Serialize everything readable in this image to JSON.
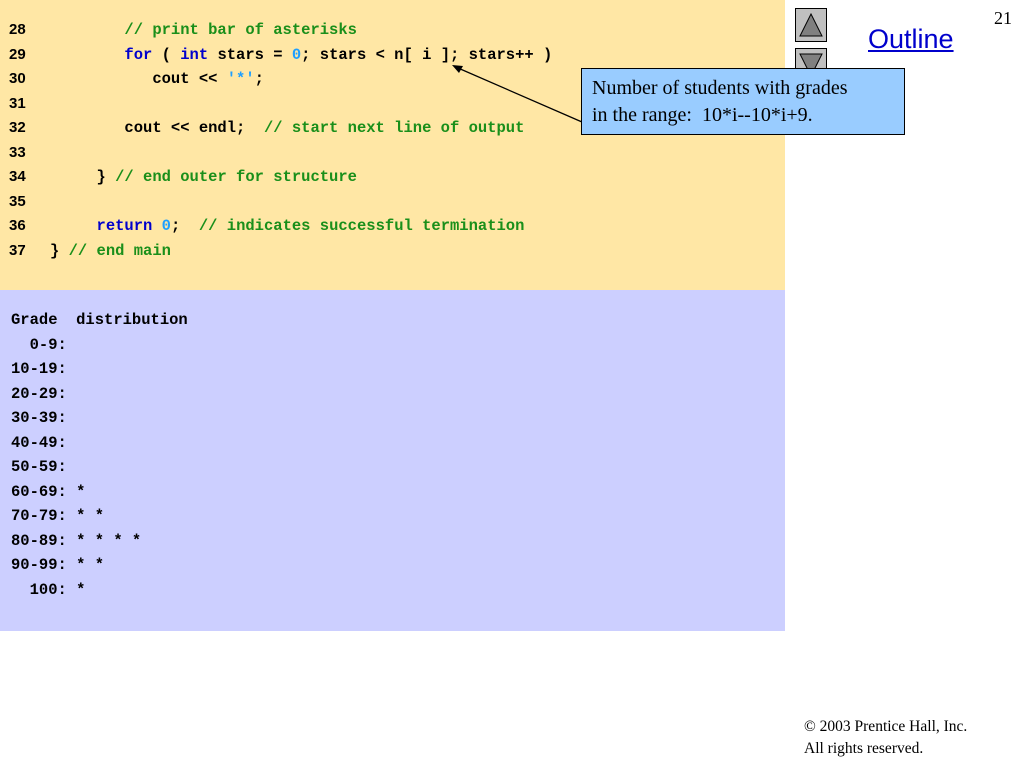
{
  "slide": {
    "page_number": "21",
    "outline_link": "Outline",
    "nav": {
      "up_icon": "triangle-up-icon",
      "down_icon": "triangle-down-icon"
    },
    "copyright": {
      "line1": "© 2003 Prentice Hall, Inc.",
      "line2": "All rights reserved."
    }
  },
  "colors": {
    "code_panel_bg": "#ffe7a5",
    "output_panel_bg": "#cccfff",
    "callout_bg": "#99ccff",
    "keyword": "#0000cc",
    "number_literal": "#1e9fff",
    "comment": "#1a8f1a"
  },
  "code": {
    "lines": [
      {
        "number": "28",
        "parts": [
          {
            "text": "        "
          },
          {
            "text": "// print bar of asterisks",
            "cls": "cm"
          }
        ]
      },
      {
        "number": "29",
        "parts": [
          {
            "text": "        "
          },
          {
            "text": "for",
            "cls": "kw"
          },
          {
            "text": " ( "
          },
          {
            "text": "int",
            "cls": "kw"
          },
          {
            "text": " stars = "
          },
          {
            "text": "0",
            "cls": "num"
          },
          {
            "text": "; stars < n[ i ]; stars++ )"
          }
        ]
      },
      {
        "number": "30",
        "parts": [
          {
            "text": "           cout << "
          },
          {
            "text": "'*'",
            "cls": "num"
          },
          {
            "text": ";"
          }
        ]
      },
      {
        "number": "31",
        "parts": [
          {
            "text": ""
          }
        ]
      },
      {
        "number": "32",
        "parts": [
          {
            "text": "        cout << endl;  "
          },
          {
            "text": "// start next line of output",
            "cls": "cm"
          }
        ]
      },
      {
        "number": "33",
        "parts": [
          {
            "text": ""
          }
        ]
      },
      {
        "number": "34",
        "parts": [
          {
            "text": "     } "
          },
          {
            "text": "// end outer for structure",
            "cls": "cm"
          }
        ]
      },
      {
        "number": "35",
        "parts": [
          {
            "text": ""
          }
        ]
      },
      {
        "number": "36",
        "parts": [
          {
            "text": "     "
          },
          {
            "text": "return",
            "cls": "kw"
          },
          {
            "text": " "
          },
          {
            "text": "0",
            "cls": "num"
          },
          {
            "text": ";  "
          },
          {
            "text": "// indicates successful termination",
            "cls": "cm"
          }
        ]
      },
      {
        "number": "37",
        "parts": [
          {
            "text": "} "
          },
          {
            "text": "// end main",
            "cls": "cm"
          }
        ]
      }
    ]
  },
  "output": {
    "lines": [
      "Grade  distribution",
      "  0-9:",
      "10-19:",
      "20-29:",
      "30-39:",
      "40-49:",
      "50-59:",
      "60-69: *",
      "70-79: * *",
      "80-89: * * * *",
      "90-99: * *",
      "  100: *"
    ]
  },
  "callout": {
    "line1": "Number of students with grades",
    "line2": "in the range:  10*i--10*i+9."
  }
}
